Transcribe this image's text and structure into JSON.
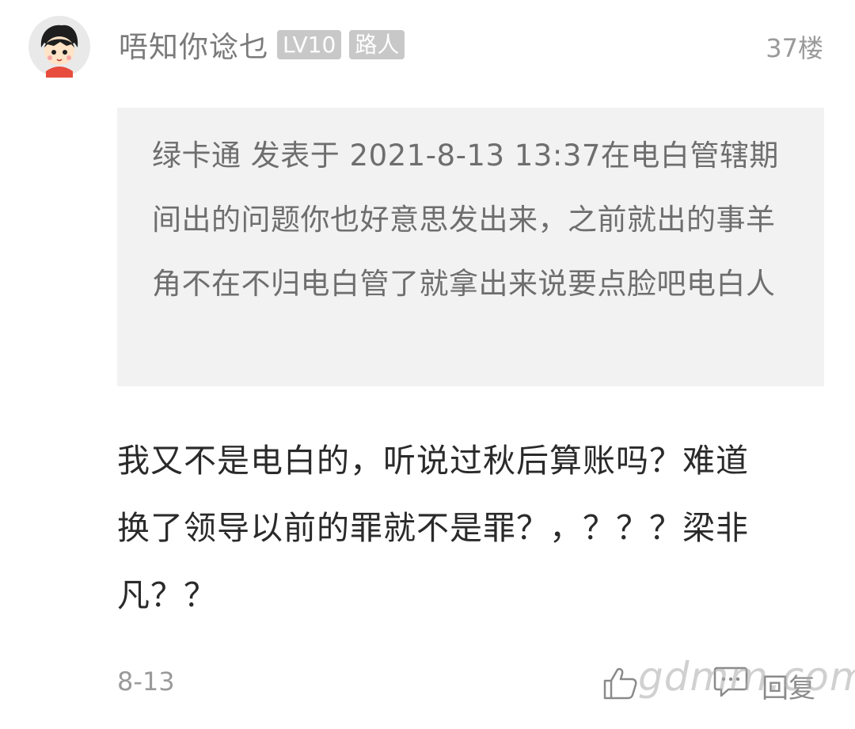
{
  "post": {
    "username": "唔知你谂乜",
    "level_badge": "LV10",
    "title_badge": "路人",
    "floor": "37楼",
    "quote": {
      "text": "绿卡通 发表于 2021-8-13 13:37在电白管辖期间出的问题你也好意思发出来，之前就出的事羊角不在不归电白管了就拿出来说要点脸吧电白人"
    },
    "content": "我又不是电白的，听说过秋后算账吗？难道换了领导以前的罪就不是罪？，？？？梁非凡？？",
    "date": "8-13",
    "reply_label": "回复"
  },
  "watermark": "gdmm.com",
  "icons": {
    "avatar": "cartoon-boy-avatar",
    "like": "thumbs-up-icon",
    "comment": "comment-bubble-icon"
  },
  "colors": {
    "badge_bg": "#c8c8c8",
    "quote_bg": "#f2f2f2",
    "text_gray": "#9a9a9a"
  }
}
